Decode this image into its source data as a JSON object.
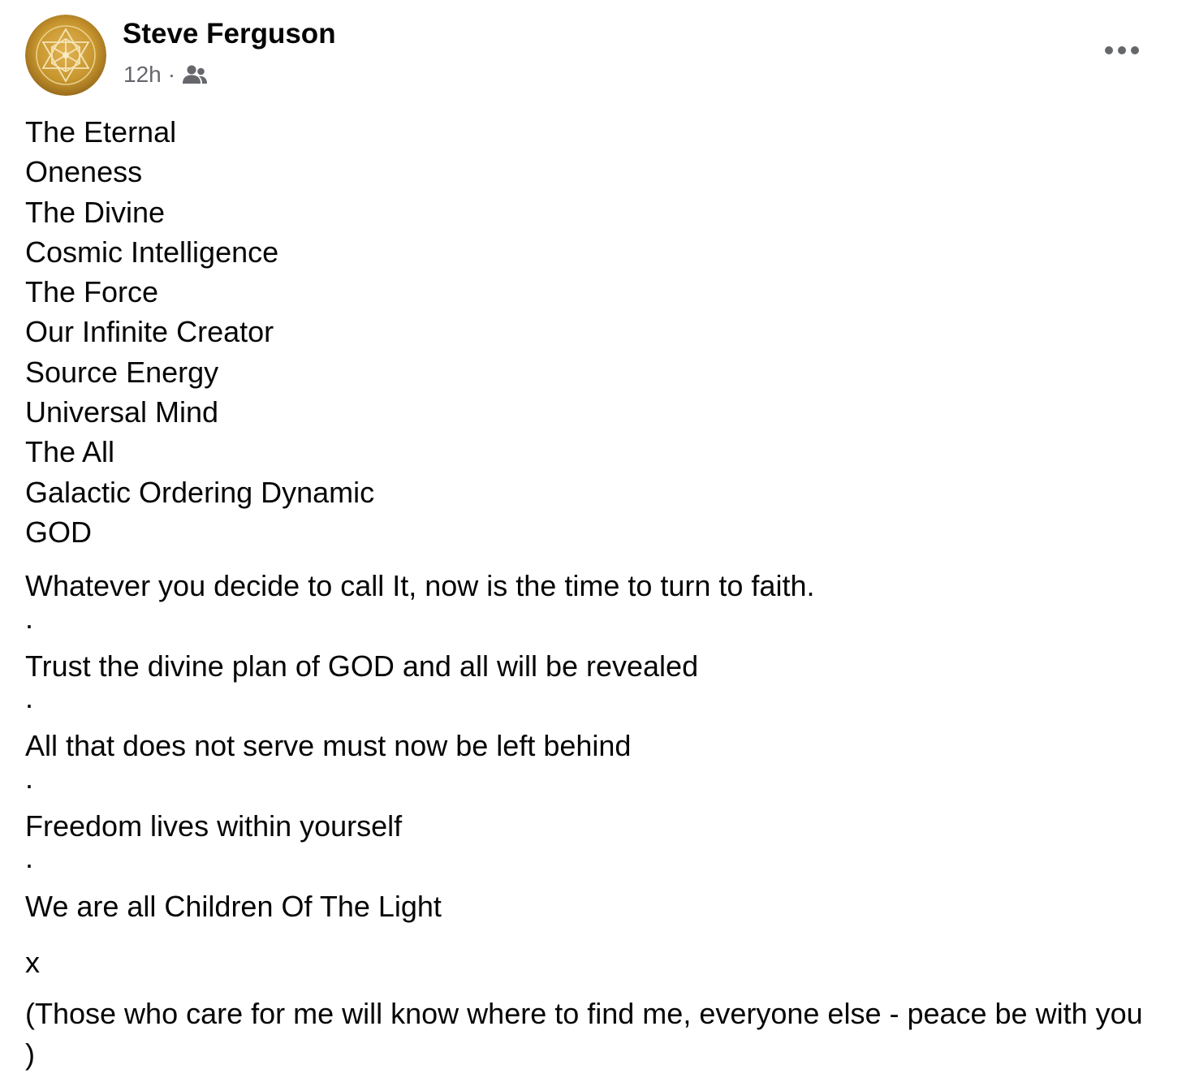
{
  "post": {
    "author": {
      "name": "Steve Ferguson",
      "avatar_icon": "sacred-geometry-avatar"
    },
    "meta": {
      "time": "12h",
      "separator": "·",
      "audience_icon": "friends-icon"
    },
    "more_icon": "more-horizontal-icon",
    "names": [
      "The Eternal",
      "Oneness",
      "The Divine",
      "Cosmic Intelligence",
      "The Force",
      "Our Infinite Creator",
      "Source Energy",
      "Universal Mind",
      "The All",
      "Galactic Ordering Dynamic",
      "GOD"
    ],
    "lines": {
      "faith": "Whatever you decide to call It, now is the time to turn to faith.",
      "trust": "Trust the divine plan of GOD and all will be revealed",
      "serve": "All that does not serve must now be left behind",
      "freedom": "Freedom lives within yourself",
      "children": "We are all Children Of The Light",
      "dot": ".",
      "sign_off": "x",
      "closing": "(Those who care for me will know where to find me, everyone else - peace be with you )"
    },
    "colors": {
      "text": "#050505",
      "secondary": "#65676b",
      "avatar_gold": "#c8962e"
    }
  }
}
